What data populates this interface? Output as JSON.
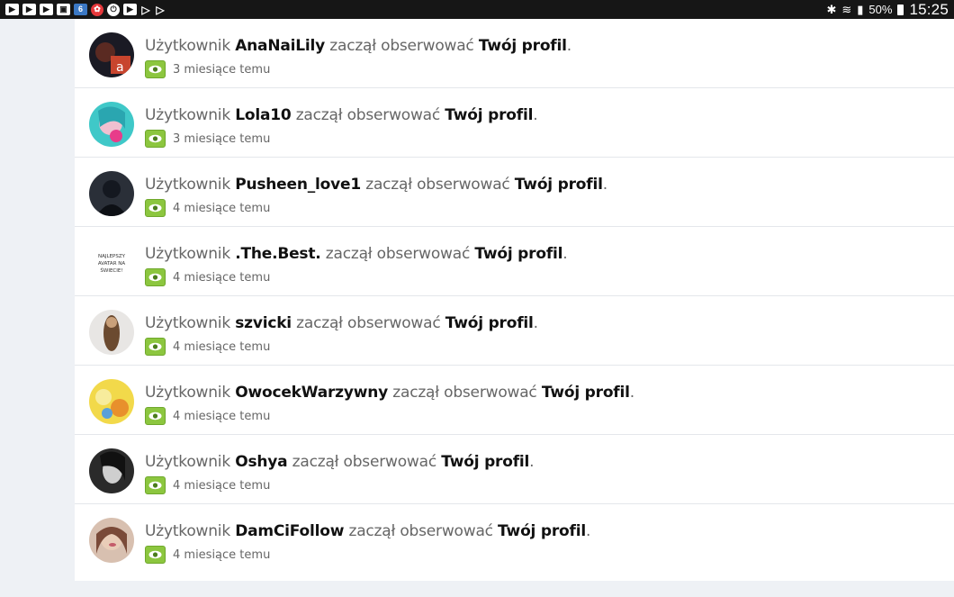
{
  "statusbar": {
    "battery": "50%",
    "time": "15:25",
    "left_icons": [
      "youtube-icon",
      "youtube-icon",
      "youtube-icon",
      "gallery-icon",
      "badge-6-icon",
      "red-app-icon",
      "power-app-icon",
      "youtube-icon",
      "play-store-icon",
      "play-store-icon"
    ],
    "six_label": "6"
  },
  "notifications": {
    "prefix": "Użytkownik",
    "action": "zaczął obserwować",
    "target": "Twój profil",
    "period": ".",
    "items": [
      {
        "user": "AnaNaiLily",
        "time": "3 miesiące temu"
      },
      {
        "user": "Lola10",
        "time": "3 miesiące temu"
      },
      {
        "user": "Pusheen_love1",
        "time": "4 miesiące temu"
      },
      {
        "user": ".The.Best.",
        "time": "4 miesiące temu",
        "avatar_text": [
          "NAJLEPSZY",
          "AVATAR NA",
          "ŚWIECIE!"
        ]
      },
      {
        "user": "szvicki",
        "time": "4 miesiące temu"
      },
      {
        "user": "OwocekWarzywny",
        "time": "4 miesiące temu"
      },
      {
        "user": "Oshya",
        "time": "4 miesiące temu"
      },
      {
        "user": "DamCiFollow",
        "time": "4 miesiące temu"
      }
    ]
  },
  "colors": {
    "badge_green": "#8cc63f",
    "statusbar_bg": "#161616",
    "page_bg": "#eef1f5"
  }
}
